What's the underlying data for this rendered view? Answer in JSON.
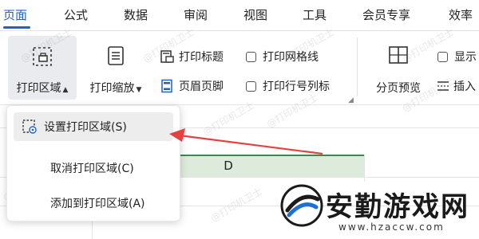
{
  "menu": {
    "tabs": [
      {
        "label": "页面",
        "active": true
      },
      {
        "label": "公式"
      },
      {
        "label": "数据"
      },
      {
        "label": "审阅"
      },
      {
        "label": "视图"
      },
      {
        "label": "工具"
      },
      {
        "label": "会员专享"
      },
      {
        "label": "效率"
      }
    ]
  },
  "ribbon": {
    "print_area": "打印区域",
    "print_scale": "打印缩放",
    "print_titles": "打印标题",
    "header_footer": "页眉页脚",
    "print_gridlines": "打印网格线",
    "print_row_col_headers": "打印行号列标",
    "page_break_preview": "分页预览",
    "show": "显示",
    "insert": "插入"
  },
  "dropdown": {
    "items": [
      {
        "label": "设置打印区域(S)",
        "icon": "set-print-area-icon"
      },
      {
        "label": "取消打印区域(C)"
      },
      {
        "label": "添加到打印区域(A)"
      }
    ]
  },
  "sheet": {
    "column_header": "D"
  },
  "watermark": "@打印机卫士",
  "logo": {
    "name": "安勤游戏网",
    "url": "www.hzaccw.com"
  },
  "colors": {
    "accent": "#1f5fd0",
    "arrow": "#e8403f",
    "column_header_bg": "#dcebdc",
    "column_header_border": "#3a8a4e"
  }
}
